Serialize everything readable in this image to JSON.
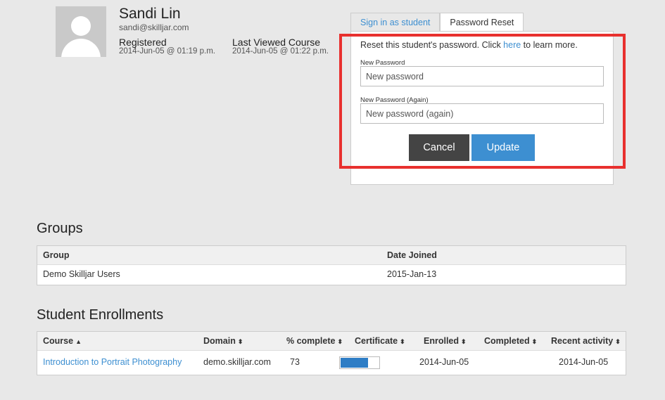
{
  "profile": {
    "name": "Sandi Lin",
    "email": "sandi@skilljar.com",
    "registered_label": "Registered",
    "registered_value": "2014-Jun-05 @ 01:19 p.m.",
    "last_viewed_label": "Last Viewed Course",
    "last_viewed_value": "2014-Jun-05 @ 01:22 p.m."
  },
  "tabs": [
    {
      "label": "Sign in as student",
      "active": false
    },
    {
      "label": "Password Reset",
      "active": true
    }
  ],
  "password_reset": {
    "intro_before": "Reset this student's password. Click ",
    "intro_link": "here",
    "intro_after": " to learn more.",
    "new_password_label": "New Password",
    "new_password_placeholder": "New password",
    "new_password_again_label": "New Password (Again)",
    "new_password_again_placeholder": "New password (again)",
    "cancel_label": "Cancel",
    "update_label": "Update"
  },
  "groups": {
    "title": "Groups",
    "columns": [
      "Group",
      "Date Joined"
    ],
    "rows": [
      {
        "group": "Demo Skilljar Users",
        "date_joined": "2015-Jan-13"
      }
    ]
  },
  "enrollments": {
    "title": "Student Enrollments",
    "columns": [
      "Course",
      "Domain",
      "% complete",
      "Certificate",
      "Enrolled",
      "Completed",
      "Recent activity"
    ],
    "sort_ascending_glyph": "▲",
    "sort_both_glyph": "⬍",
    "rows": [
      {
        "course": "Introduction to Portrait Photography",
        "domain": "demo.skilljar.com",
        "percent_complete": "73",
        "progress_fraction": 0.73,
        "certificate": "",
        "enrolled": "2014-Jun-05",
        "completed": "",
        "recent_activity": "2014-Jun-05"
      }
    ]
  },
  "colors": {
    "link": "#3d8fd1",
    "update_button": "#3d8fd1",
    "cancel_button": "#444444",
    "highlight": "#e8302e",
    "progress_fill": "#2e7dc5"
  }
}
